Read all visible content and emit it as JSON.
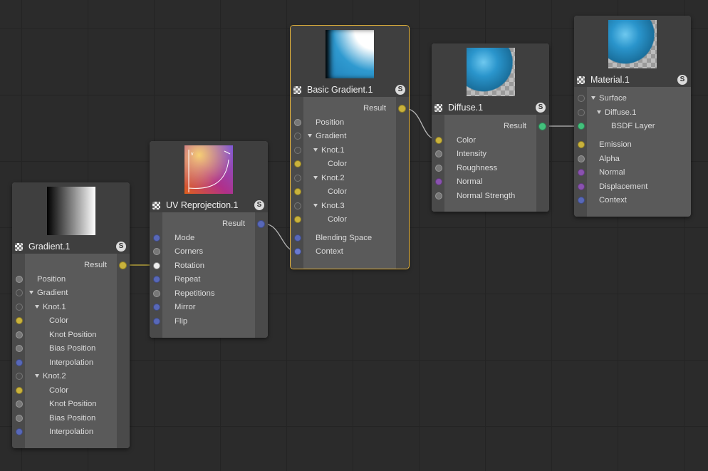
{
  "nodes": {
    "gradient": {
      "title": "Gradient.1",
      "result": "Result",
      "rows": [
        "Position",
        "Gradient",
        "Knot.1",
        "Color",
        "Knot Position",
        "Bias Position",
        "Interpolation",
        "Knot.2",
        "Color",
        "Knot Position",
        "Bias Position",
        "Interpolation"
      ]
    },
    "uv": {
      "title": "UV Reprojection.1",
      "result": "Result",
      "rows": [
        "Mode",
        "Corners",
        "Rotation",
        "Repeat",
        "Repetitions",
        "Mirror",
        "Flip"
      ]
    },
    "basic": {
      "title": "Basic Gradient.1",
      "result": "Result",
      "rows": [
        "Position",
        "Gradient",
        "Knot.1",
        "Color",
        "Knot.2",
        "Color",
        "Knot.3",
        "Color",
        "Blending Space",
        "Context"
      ]
    },
    "diffuse": {
      "title": "Diffuse.1",
      "result": "Result",
      "rows": [
        "Color",
        "Intensity",
        "Roughness",
        "Normal",
        "Normal Strength"
      ]
    },
    "material": {
      "title": "Material.1",
      "rows": [
        "Surface",
        "Diffuse.1",
        "BSDF Layer",
        "Emission",
        "Alpha",
        "Normal",
        "Displacement",
        "Context"
      ]
    }
  },
  "solo_label": "S",
  "colors": {
    "port_yellow": "#c9b23c",
    "port_blue": "#5868b8",
    "port_purple": "#8a52b0",
    "port_green": "#43c17c",
    "selection": "#e8b53a"
  },
  "icons": [
    "node-icon",
    "solo-icon",
    "triangle-expand-icon"
  ]
}
